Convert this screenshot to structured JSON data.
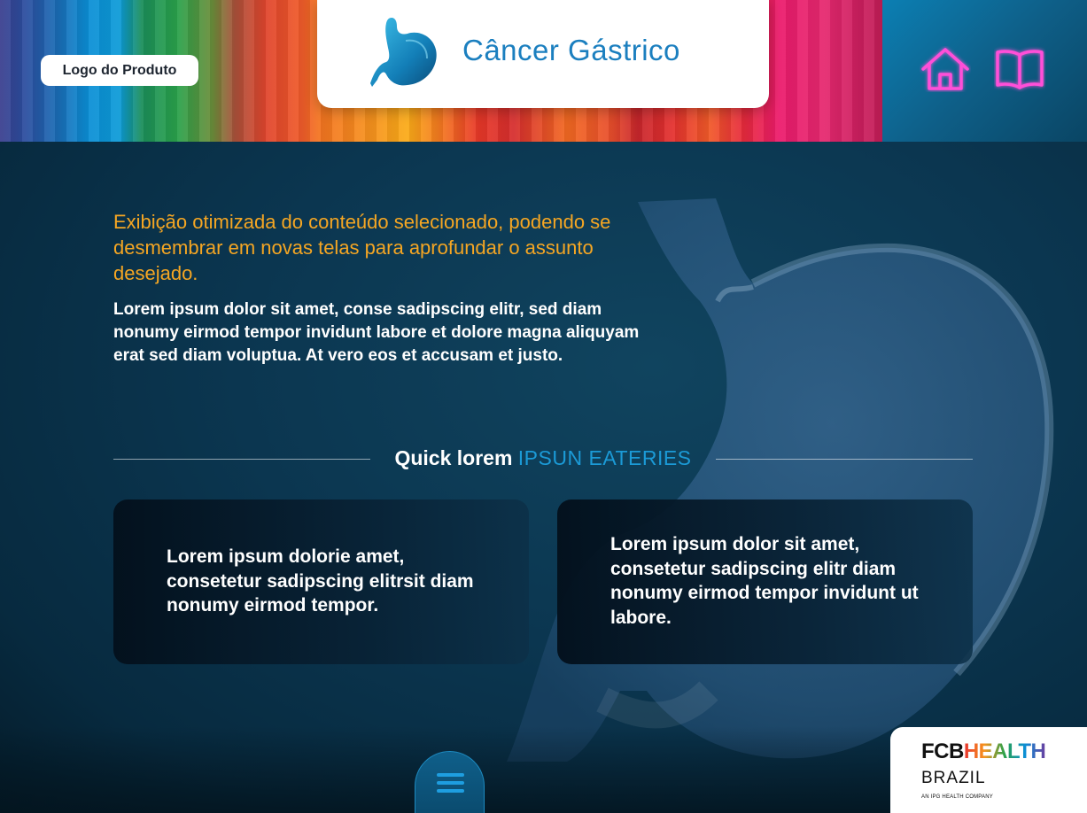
{
  "header": {
    "logo_label": "Logo do Produto",
    "title": "Câncer Gástrico",
    "icons": {
      "stomach": "stomach-icon",
      "home": "home-icon",
      "book": "book-icon"
    },
    "neon_color": "#ff4fd8"
  },
  "main": {
    "intro": "Exibição otimizada do conteúdo selecionado, podendo se desmembrar em novas telas para aprofundar o assunto desejado.",
    "body": "Lorem ipsum dolor sit amet, conse sadipscing elitr, sed diam nonumy eirmod tempor invidunt labore et dolore magna aliquyam erat sed diam voluptua. At vero eos et accusam et justo.",
    "section_title_a": "Quick lorem",
    "section_title_b": "IPSUN EATERIES",
    "cards": [
      {
        "text": "Lorem ipsum dolorie amet, consetetur sadipscing elitrsit diam nonumy eirmod tempor."
      },
      {
        "text": "Lorem ipsum dolor sit amet, consetetur sadipscing elitr diam nonumy eirmod tempor invidunt ut labore."
      }
    ]
  },
  "footer": {
    "menu_icon": "menu-icon",
    "brand_fcb": "FCB",
    "brand_health": "HEALTH",
    "brand_country": "BRAZIL",
    "brand_tagline": "AN IPG HEALTH COMPANY"
  },
  "colors": {
    "accent_orange": "#f5a623",
    "accent_blue": "#1b9ad6",
    "title_blue": "#1b7fbf",
    "background": "#0b3650"
  }
}
